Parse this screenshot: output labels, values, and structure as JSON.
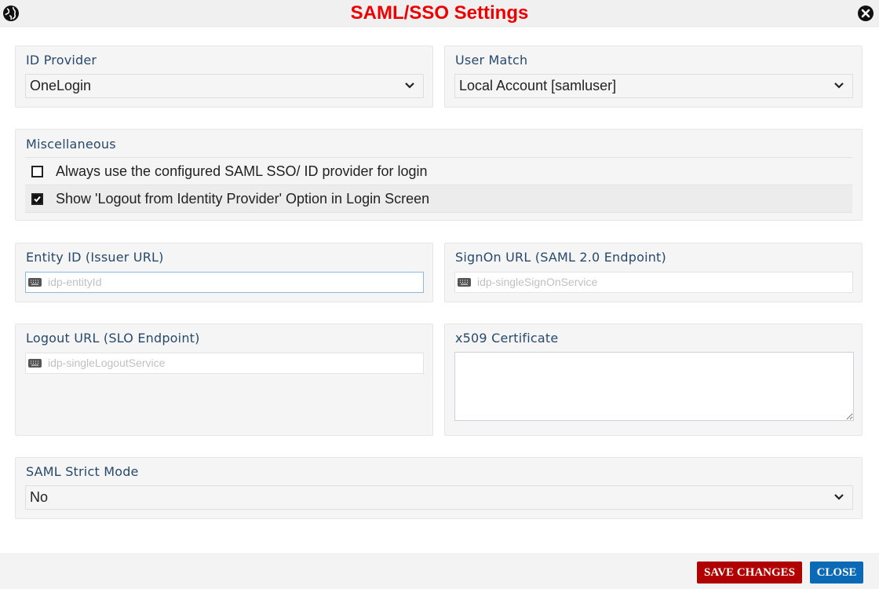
{
  "header": {
    "title": "SAML/SSO Settings",
    "left_icon": "globe-icon",
    "right_icon": "close-circle-icon",
    "title_color": "#ee0000"
  },
  "id_provider": {
    "label": "ID Provider",
    "selected": "OneLogin"
  },
  "user_match": {
    "label": "User Match",
    "selected": "Local Account [samluser]"
  },
  "miscellaneous": {
    "label": "Miscellaneous",
    "options": [
      {
        "label": "Always use the configured SAML SSO/ ID provider for login",
        "checked": false
      },
      {
        "label": "Show 'Logout from Identity Provider' Option in Login Screen",
        "checked": true
      }
    ]
  },
  "entity_id": {
    "label": "Entity ID (Issuer URL)",
    "value": "",
    "placeholder": "idp-entityId"
  },
  "signon_url": {
    "label": "SignOn URL (SAML 2.0 Endpoint)",
    "value": "",
    "placeholder": "idp-singleSignOnService"
  },
  "logout_url": {
    "label": "Logout URL (SLO Endpoint)",
    "value": "",
    "placeholder": "idp-singleLogoutService"
  },
  "x509": {
    "label": "x509 Certificate",
    "value": ""
  },
  "strict_mode": {
    "label": "SAML Strict Mode",
    "selected": "No"
  },
  "footer": {
    "save_label": "SAVE CHANGES",
    "close_label": "CLOSE",
    "save_color": "#b00000",
    "close_color": "#0a6ab5"
  }
}
